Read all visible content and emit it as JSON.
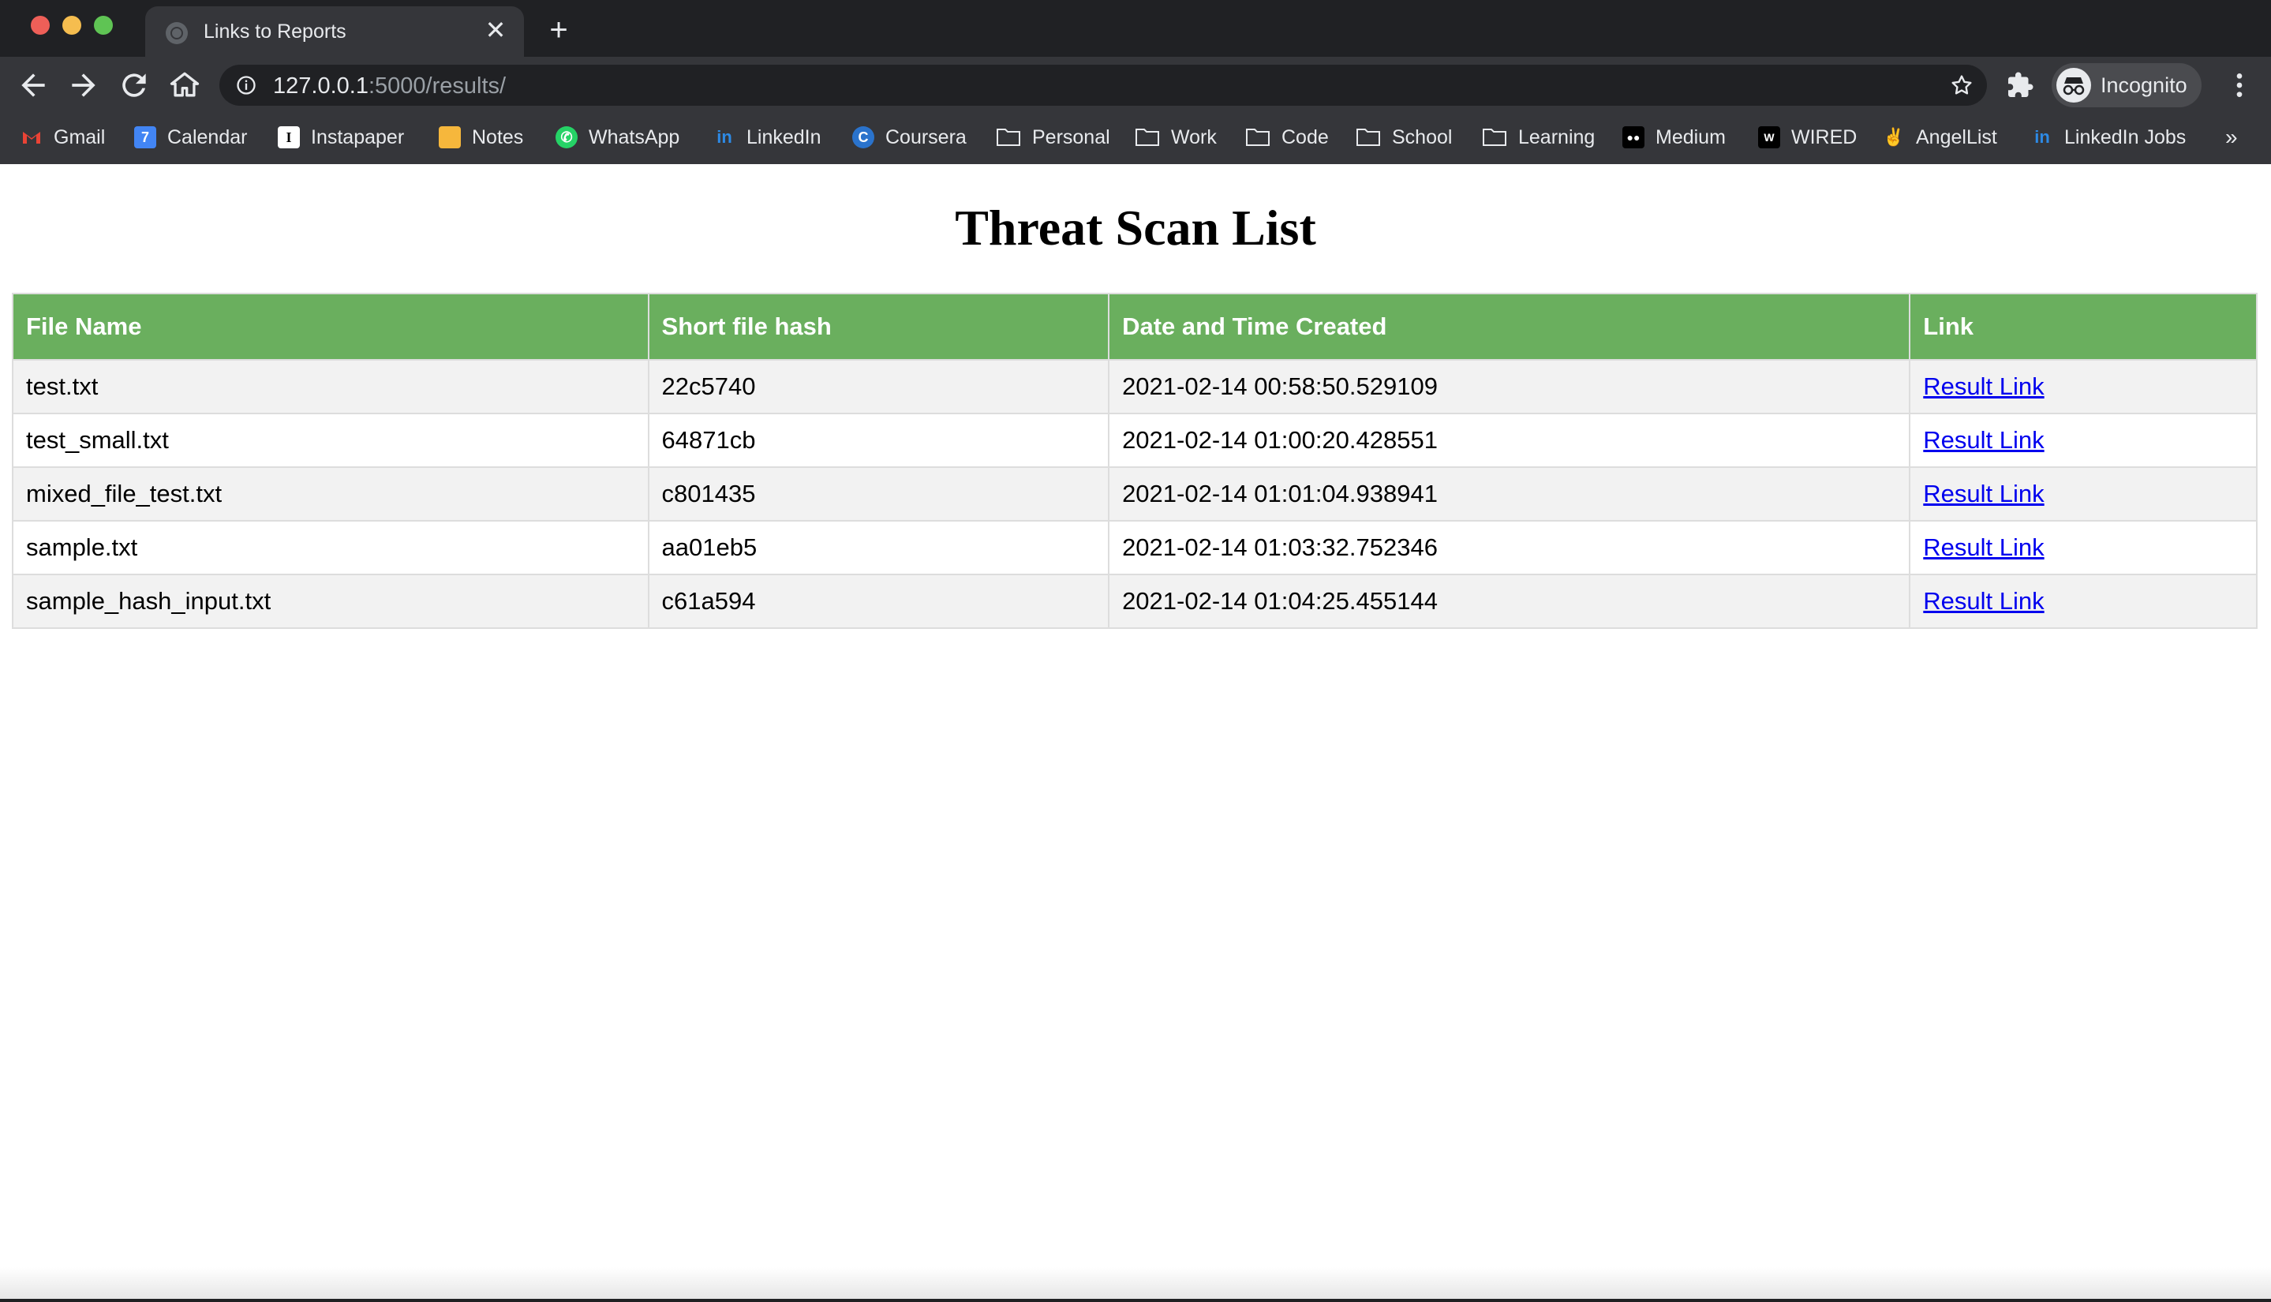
{
  "browser": {
    "tab": {
      "title": "Links to Reports",
      "close_glyph": "✕"
    },
    "new_tab_glyph": "+",
    "address": {
      "host": "127.0.0.1",
      "path": ":5000/results/"
    },
    "profile_label": "Incognito",
    "bookmarks": [
      {
        "label": "Gmail",
        "icon": "gmail-icon"
      },
      {
        "label": "Calendar",
        "icon": "calendar-icon"
      },
      {
        "label": "Instapaper",
        "icon": "instapaper-icon"
      },
      {
        "label": "Notes",
        "icon": "notes-icon"
      },
      {
        "label": "WhatsApp",
        "icon": "whatsapp-icon"
      },
      {
        "label": "LinkedIn",
        "icon": "linkedin-icon"
      },
      {
        "label": "Coursera",
        "icon": "coursera-icon"
      },
      {
        "label": "Personal",
        "icon": "folder-icon"
      },
      {
        "label": "Work",
        "icon": "folder-icon"
      },
      {
        "label": "Code",
        "icon": "folder-icon"
      },
      {
        "label": "School",
        "icon": "folder-icon"
      },
      {
        "label": "Learning",
        "icon": "folder-icon"
      },
      {
        "label": "Medium",
        "icon": "medium-icon"
      },
      {
        "label": "WIRED",
        "icon": "wired-icon"
      },
      {
        "label": "AngelList",
        "icon": "angellist-icon"
      },
      {
        "label": "LinkedIn Jobs",
        "icon": "linkedin-icon"
      }
    ],
    "bookmarks_overflow": "»"
  },
  "page": {
    "heading": "Threat Scan List",
    "table": {
      "headers": [
        "File Name",
        "Short file hash",
        "Date and Time Created",
        "Link"
      ],
      "rows": [
        [
          "test.txt",
          "22c5740",
          "2021-02-14 00:58:50.529109",
          "Result Link"
        ],
        [
          "test_small.txt",
          "64871cb",
          "2021-02-14 01:00:20.428551",
          "Result Link"
        ],
        [
          "mixed_file_test.txt",
          "c801435",
          "2021-02-14 01:01:04.938941",
          "Result Link"
        ],
        [
          "sample.txt",
          "aa01eb5",
          "2021-02-14 01:03:32.752346",
          "Result Link"
        ],
        [
          "sample_hash_input.txt",
          "c61a594",
          "2021-02-14 01:04:25.455144",
          "Result Link"
        ]
      ]
    }
  },
  "colors": {
    "header_bg": "#6aaf5e",
    "link": "#0000ee",
    "stripe": "#f2f2f2"
  }
}
